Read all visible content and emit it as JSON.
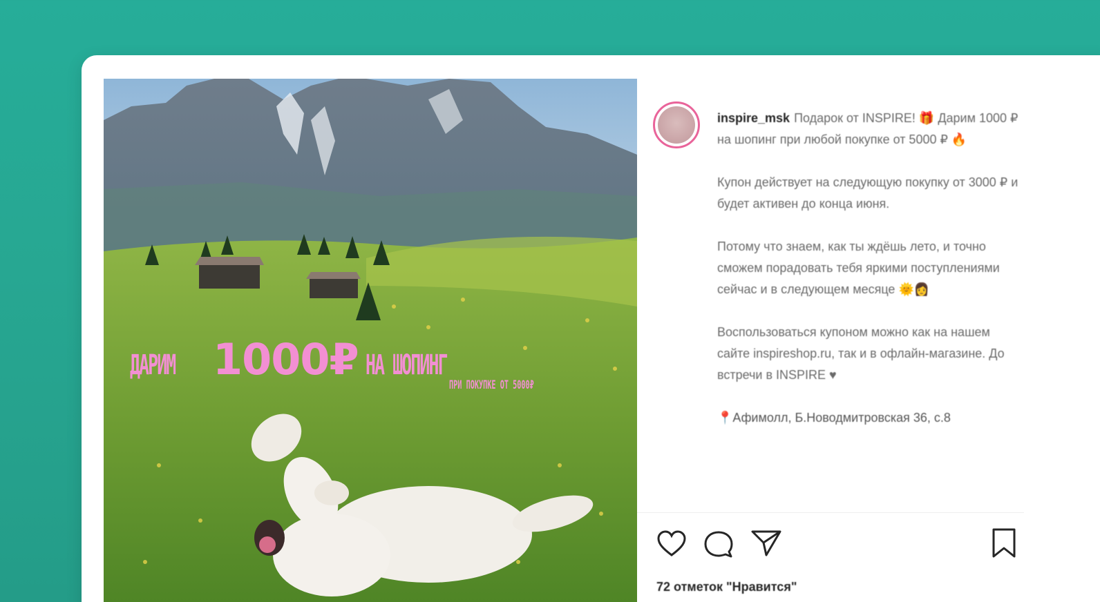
{
  "post": {
    "image": {
      "headline_left": "ДАРИМ",
      "headline_amount": "1000₽",
      "headline_right": "НА ШОПИНГ",
      "subline": "ПРИ ПОКУПКЕ ОТ 5000₽"
    },
    "author": {
      "username": "inspire_msk"
    },
    "caption": {
      "line1": "Подарок от INSPIRE! 🎁 Дарим 1000 ₽ на шопинг при любой покупке от 5000 ₽ 🔥",
      "paragraph2": "Купон действует на следующую покупку от 3000 ₽ и будет активен до конца июня.",
      "paragraph3": "Потому что знаем, как ты ждёшь лето, и точно сможем порадовать тебя яркими поступлениями сейчас и в следующем месяце 🌞👩",
      "paragraph4": "Воспользоваться купоном можно как на нашем сайте inspireshop.ru, так и в офлайн-магазине. До встречи в INSPIRE ♥",
      "location": "📍Афимолл, Б.Новодмитровская 36, с.8"
    },
    "likes_text": "72 отметок \"Нравится\"",
    "icons": {
      "like": "heart-icon",
      "comment": "comment-icon",
      "share": "share-icon",
      "save": "bookmark-icon"
    }
  }
}
